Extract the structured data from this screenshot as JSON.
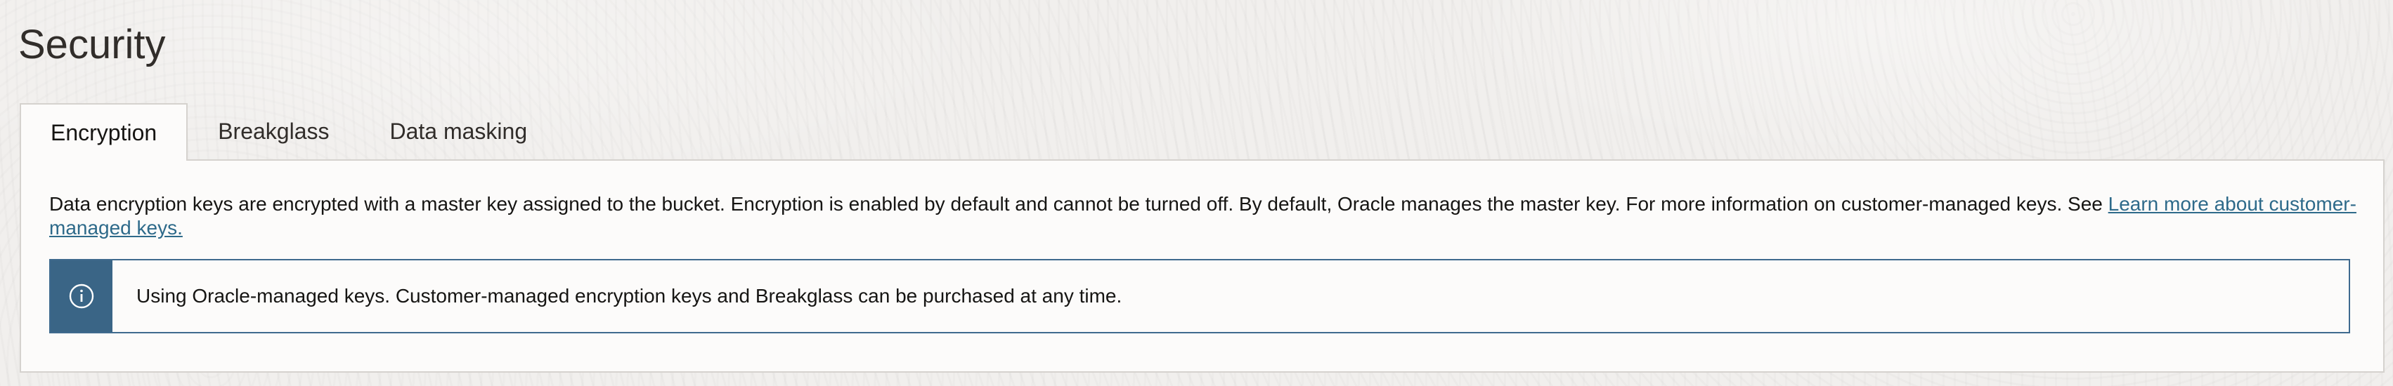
{
  "page": {
    "title": "Security"
  },
  "tabs": [
    {
      "label": "Encryption",
      "active": true
    },
    {
      "label": "Breakglass",
      "active": false
    },
    {
      "label": "Data masking",
      "active": false
    }
  ],
  "encryption": {
    "description": "Data encryption keys are encrypted with a master key assigned to the bucket. Encryption is enabled by default and cannot be turned off. By default, Oracle manages the master key. For more information on customer-managed keys. See ",
    "link_text": "Learn more about customer-managed keys.",
    "info_icon": "info-circle-icon",
    "info_message": "Using Oracle-managed keys. Customer-managed encryption keys and Breakglass can be purchased at any time."
  },
  "colors": {
    "info_accent": "#3a6586",
    "link": "#2e6a8a",
    "panel_bg": "#fcfbfa",
    "page_bg": "#f1efed"
  }
}
